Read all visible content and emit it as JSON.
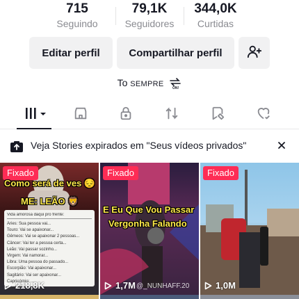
{
  "stats": [
    {
      "value": "715",
      "label": "Seguindo"
    },
    {
      "value": "79,1K",
      "label": "Seguidores"
    },
    {
      "value": "344,0K",
      "label": "Curtidas"
    }
  ],
  "buttons": {
    "edit_profile": "Editar perfil",
    "share_profile": "Compartilhar perfil",
    "add_friend_icon": "add-user-icon"
  },
  "bio": {
    "prefix": "To",
    "caps": "SEMPRE",
    "emoji_icon": "on-arrows-icon"
  },
  "tabs": [
    {
      "icon": "grid-icon",
      "active": true
    },
    {
      "icon": "shop-icon"
    },
    {
      "icon": "lock-icon"
    },
    {
      "icon": "repost-icon"
    },
    {
      "icon": "bookmark-icon"
    },
    {
      "icon": "liked-icon"
    }
  ],
  "notice": {
    "text": "Veja Stories expirados em \"Seus vídeos privados\"",
    "close_icon": "close-icon"
  },
  "videos": [
    {
      "pinned_label": "Fixado",
      "views": "218,8K",
      "caption": "Como será de ves 😔",
      "caption2": "ME: LEÃO 🦁",
      "note_header": "Vida amorosa daqui pro frente:",
      "signs": [
        "Áries: Sua pessoa vai...",
        "Touro: Vai se apaixonar...",
        "Gêmeos: Vai se apaixonar 2 pessoas...",
        "Câncer: Vai ter a pessoa certa...",
        "Leão: Vai passar sozinho...",
        "Virgem: Vai namorar...",
        "Libra: Uma pessoa do passado...",
        "Escorpião: Vai apaixonar...",
        "Sagitário: Vai ser apaixonar...",
        "Capricórnio: ...",
        "Aquário: ..."
      ]
    },
    {
      "pinned_label": "Fixado",
      "views": "1,7M",
      "caption": "E Eu Que Vou Passar",
      "caption2": "Vergonha Falando",
      "watermark": "@_NUNHAFF.20"
    },
    {
      "pinned_label": "Fixado",
      "views": "1,0M"
    }
  ],
  "colors": {
    "pin": "#fe2c55",
    "text": "#161823",
    "muted": "#8a8b91",
    "button_bg": "#f1f1f2"
  }
}
